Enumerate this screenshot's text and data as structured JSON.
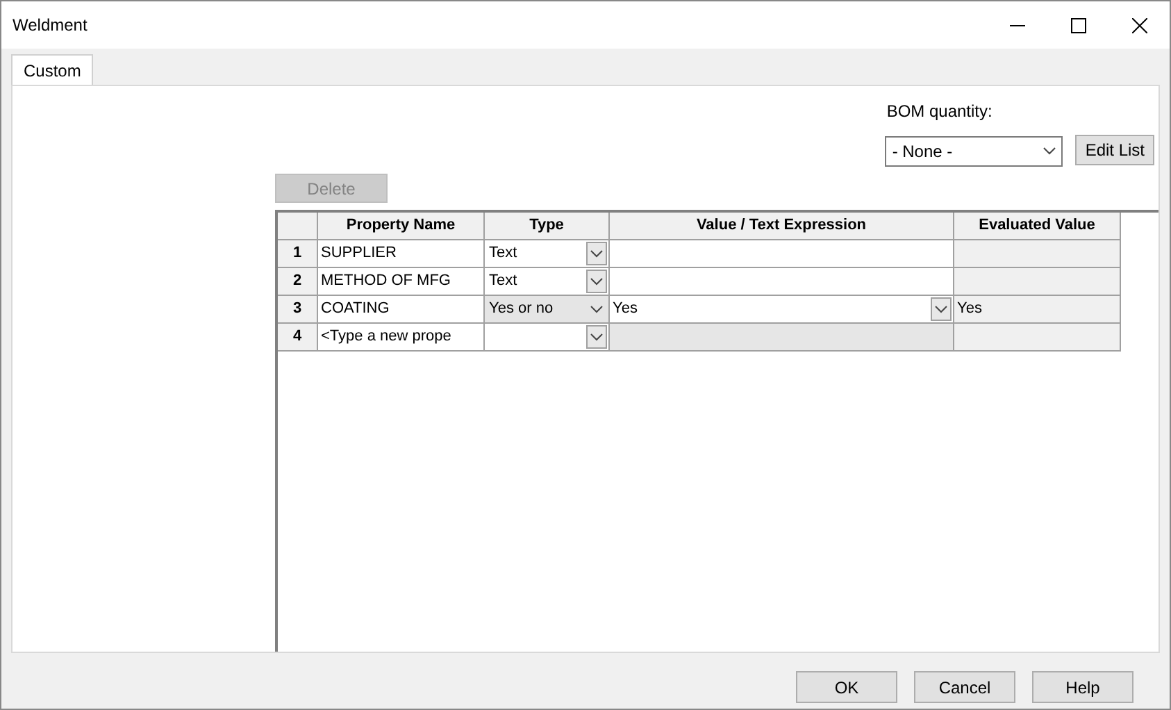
{
  "window": {
    "title": "Weldment"
  },
  "tabs": [
    {
      "label": "Custom",
      "selected": true
    }
  ],
  "bom_quantity": {
    "label": "BOM quantity:",
    "value": "- None -"
  },
  "edit_list_button": "Edit List",
  "delete_button": {
    "label": "Delete",
    "disabled": true
  },
  "table": {
    "columns": [
      "Property Name",
      "Type",
      "Value / Text Expression",
      "Evaluated Value"
    ],
    "rows": [
      {
        "number": "1",
        "name": "SUPPLIER",
        "type": "Text",
        "type_focused": false,
        "value_dropdown": false,
        "value_disabled": false
      },
      {
        "number": "2",
        "name": "METHOD OF MFG",
        "type": "Text",
        "type_focused": false,
        "value_dropdown": false,
        "value_disabled": false
      },
      {
        "number": "3",
        "name": "COATING",
        "type": "Yes or no",
        "type_focused": true,
        "value": "Yes",
        "value_dropdown": true,
        "value_disabled": false,
        "evaluated": "Yes"
      },
      {
        "number": "4",
        "name": "<Type a new prope",
        "type_focused": false,
        "value_dropdown": false,
        "value_disabled": true
      }
    ]
  },
  "buttons": [
    "OK",
    "Cancel",
    "Help"
  ]
}
